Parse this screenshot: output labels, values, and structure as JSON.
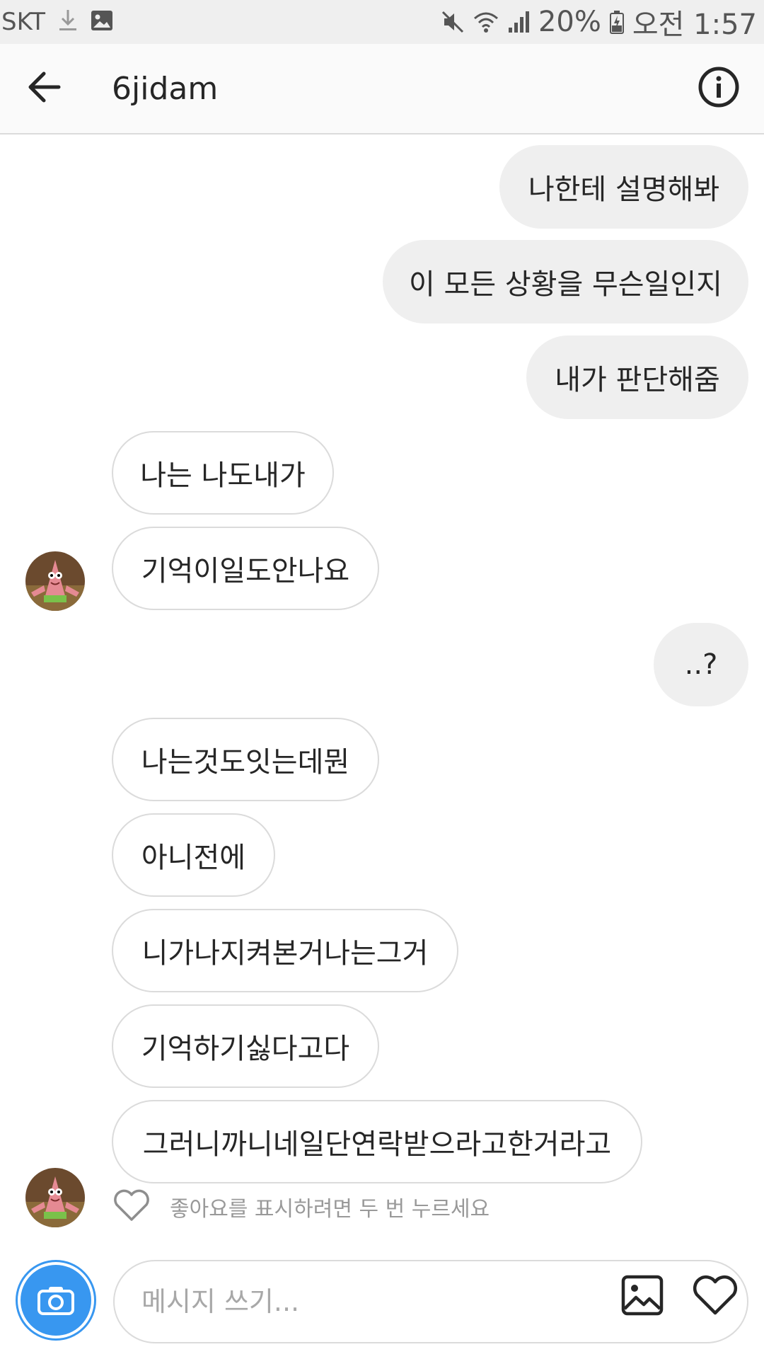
{
  "status_bar": {
    "carrier": "SKT",
    "battery": "20%",
    "time": "오전 1:57"
  },
  "header": {
    "title": "6jidam"
  },
  "messages": [
    {
      "text": "나한테 설명해봐",
      "direction": "out"
    },
    {
      "text": "이 모든 상황을 무슨일인지",
      "direction": "out"
    },
    {
      "text": "내가 판단해줌",
      "direction": "out"
    },
    {
      "text": "나는 나도내가",
      "direction": "in"
    },
    {
      "text": "기억이일도안나요",
      "direction": "in"
    },
    {
      "text": "..?",
      "direction": "out"
    },
    {
      "text": "나는것도잇는데뭔",
      "direction": "in"
    },
    {
      "text": "아니전에",
      "direction": "in"
    },
    {
      "text": "니가나지켜본거나는그거",
      "direction": "in"
    },
    {
      "text": "기억하기싫다고다",
      "direction": "in"
    },
    {
      "text": "그러니까니네일단연락받으라고한거라고",
      "direction": "in"
    }
  ],
  "like_hint": "좋아요를 표시하려면 두 번 누르세요",
  "composer": {
    "placeholder": "메시지 쓰기..."
  },
  "colors": {
    "accent": "#3897f0",
    "outgoing_bubble": "#efefef",
    "incoming_border": "#dbdbdb"
  }
}
